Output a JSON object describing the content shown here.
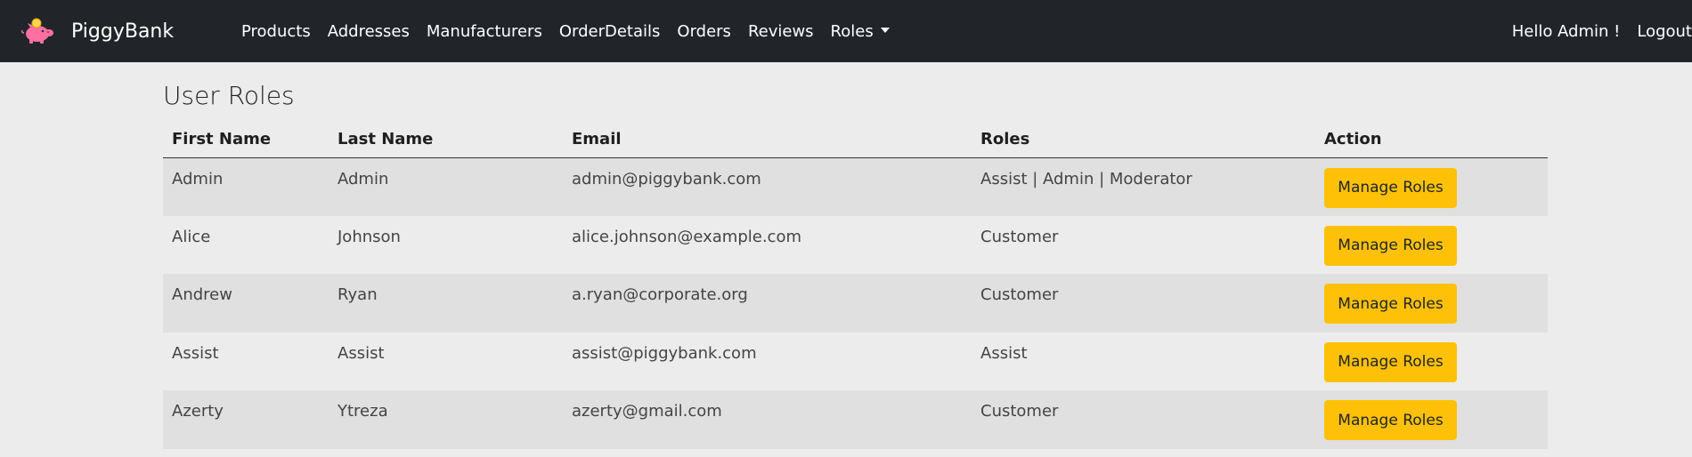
{
  "brand": {
    "name": "PiggyBank",
    "logo_icon": "piggy-bank-icon"
  },
  "nav": {
    "items": [
      {
        "label": "Products"
      },
      {
        "label": "Addresses"
      },
      {
        "label": "Manufacturers"
      },
      {
        "label": "OrderDetails"
      },
      {
        "label": "Orders"
      },
      {
        "label": "Reviews"
      },
      {
        "label": "Roles"
      }
    ],
    "greeting": "Hello Admin !",
    "logout": "Logout"
  },
  "page": {
    "title": "User Roles"
  },
  "table": {
    "headers": [
      "First Name",
      "Last Name",
      "Email",
      "Roles",
      "Action"
    ],
    "rows": [
      {
        "first": "Admin",
        "last": "Admin",
        "email": "admin@piggybank.com",
        "roles": "Assist | Admin | Moderator",
        "action": "Manage Roles"
      },
      {
        "first": "Alice",
        "last": "Johnson",
        "email": "alice.johnson@example.com",
        "roles": "Customer",
        "action": "Manage Roles"
      },
      {
        "first": "Andrew",
        "last": "Ryan",
        "email": "a.ryan@corporate.org",
        "roles": "Customer",
        "action": "Manage Roles"
      },
      {
        "first": "Assist",
        "last": "Assist",
        "email": "assist@piggybank.com",
        "roles": "Assist",
        "action": "Manage Roles"
      },
      {
        "first": "Azerty",
        "last": "Ytreza",
        "email": "azerty@gmail.com",
        "roles": "Customer",
        "action": "Manage Roles"
      }
    ]
  },
  "colors": {
    "navbar": "#212529",
    "accent": "#ffc107",
    "background": "#ececec"
  }
}
